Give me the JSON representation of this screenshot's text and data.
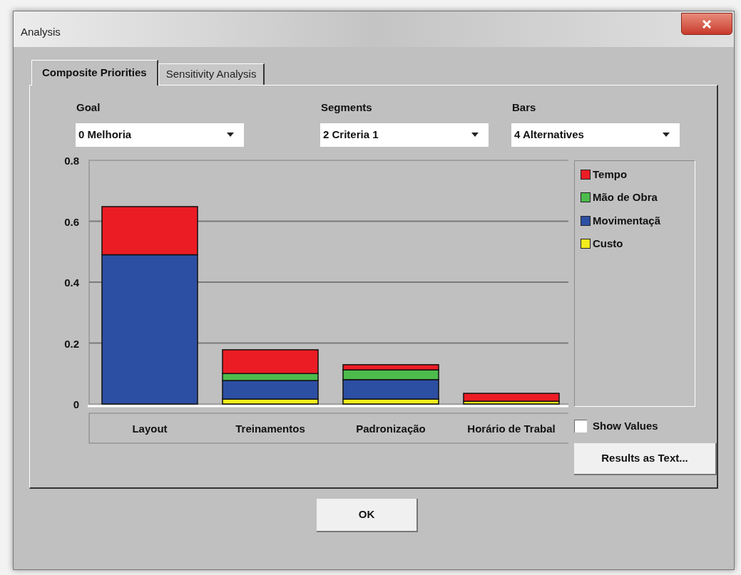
{
  "window": {
    "title": "Analysis"
  },
  "tabs": [
    {
      "label": "Composite Priorities",
      "selected": true
    },
    {
      "label": "Sensitivity Analysis",
      "selected": false
    }
  ],
  "selectors": [
    {
      "label": "Goal",
      "value": "0 Melhoria"
    },
    {
      "label": "Segments",
      "value": "2 Criteria 1"
    },
    {
      "label": "Bars",
      "value": "4 Alternatives"
    }
  ],
  "chart_data": {
    "type": "bar",
    "stacked": true,
    "grid": true,
    "legend": "right",
    "orientation": "vertical",
    "categories": [
      "Layout",
      "Treinamentos",
      "Padronização",
      "Horário de Trabal"
    ],
    "ylim": [
      0,
      0.8
    ],
    "yticks": [
      0,
      0.2,
      0.4,
      0.6,
      0.8
    ],
    "series": [
      {
        "name": "Custo",
        "color": "#f4ec1c",
        "values": [
          0,
          0.016,
          0.016,
          0.009
        ]
      },
      {
        "name": "Movimentaçã",
        "color": "#2d4fa3",
        "values": [
          0.49,
          0.061,
          0.064,
          0
        ]
      },
      {
        "name": "Mão de Obra",
        "color": "#4cbb4c",
        "values": [
          0,
          0.023,
          0.032,
          0
        ]
      },
      {
        "name": "Tempo",
        "color": "#ec1c24",
        "values": [
          0.158,
          0.078,
          0.017,
          0.026
        ]
      }
    ]
  },
  "show_values": {
    "label": "Show Values",
    "checked": false
  },
  "buttons": {
    "results": "Results as Text...",
    "ok": "OK"
  }
}
